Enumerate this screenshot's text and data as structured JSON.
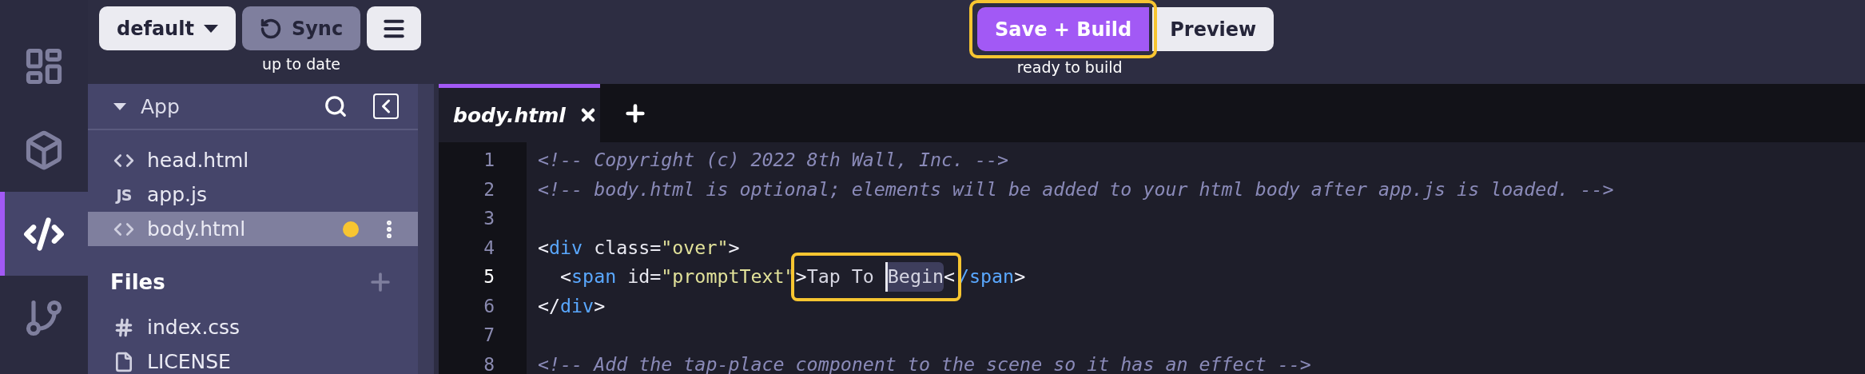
{
  "rail": [
    {
      "selected": false
    },
    {
      "selected": false
    },
    {
      "selected": true
    },
    {
      "selected": false
    }
  ],
  "toolbar": {
    "branch": "default",
    "sync": {
      "label": "Sync",
      "status": "up to date"
    },
    "build": {
      "label": "Save + Build",
      "highlighted": true
    },
    "preview": {
      "label": "Preview"
    },
    "build_status": "ready to build"
  },
  "sidebar": {
    "title": "App",
    "expanded": true,
    "app_files": [
      {
        "name": "head.html",
        "kind": "markup",
        "selected": false,
        "modified": false
      },
      {
        "name": "app.js",
        "kind": "script",
        "icon_label": "JS",
        "selected": false,
        "modified": false
      },
      {
        "name": "body.html",
        "kind": "markup",
        "selected": true,
        "modified": true
      }
    ],
    "files_title": "Files",
    "files": [
      {
        "name": "index.css",
        "kind": "style",
        "selected": false,
        "modified": false
      },
      {
        "name": "LICENSE",
        "kind": "plain",
        "selected": false,
        "modified": false
      }
    ]
  },
  "editor": {
    "tabs": [
      {
        "label": "body.html",
        "selected": true
      }
    ],
    "lines": [
      {
        "number": "1",
        "current": false,
        "tokens": [
          {
            "kind": "comment",
            "text": "<!-- Copyright (c) 2022 8th Wall, Inc. -->"
          }
        ]
      },
      {
        "number": "2",
        "current": false,
        "tokens": [
          {
            "kind": "comment",
            "text": "<!-- body.html is optional; elements will be added to your html body after app.js is loaded. -->"
          }
        ]
      },
      {
        "number": "3",
        "current": false
      },
      {
        "number": "4",
        "current": false,
        "tokens": [
          {
            "kind": "punct",
            "text": "<"
          },
          {
            "kind": "tag",
            "text": "div"
          },
          {
            "kind": "attr",
            "text": " class="
          },
          {
            "kind": "string",
            "text": "\"over\""
          },
          {
            "kind": "punct",
            "text": ">"
          }
        ]
      },
      {
        "number": "5",
        "current": true,
        "tokens": [
          {
            "kind": "punct",
            "text": "  <"
          },
          {
            "kind": "tag",
            "text": "span"
          },
          {
            "kind": "attr",
            "text": " id="
          },
          {
            "kind": "string",
            "text": "\"promptText\""
          },
          {
            "kind": "group",
            "boxed": true,
            "tokens": [
              {
                "kind": "punct",
                "text": ">"
              },
              {
                "kind": "text",
                "text": "Tap To "
              },
              {
                "kind": "text",
                "text": "Begin",
                "selected": true
              },
              {
                "kind": "punct",
                "text": "<"
              }
            ]
          },
          {
            "kind": "tag",
            "text": "/span"
          },
          {
            "kind": "punct",
            "text": ">"
          }
        ]
      },
      {
        "number": "6",
        "current": false,
        "tokens": [
          {
            "kind": "punct",
            "text": "</"
          },
          {
            "kind": "tag",
            "text": "div"
          },
          {
            "kind": "punct",
            "text": ">"
          }
        ]
      },
      {
        "number": "7",
        "current": false
      },
      {
        "number": "8",
        "current": false,
        "tokens": [
          {
            "kind": "comment",
            "text": "<!-- Add the tap-place component to the scene so it has an effect -->"
          }
        ]
      }
    ]
  }
}
